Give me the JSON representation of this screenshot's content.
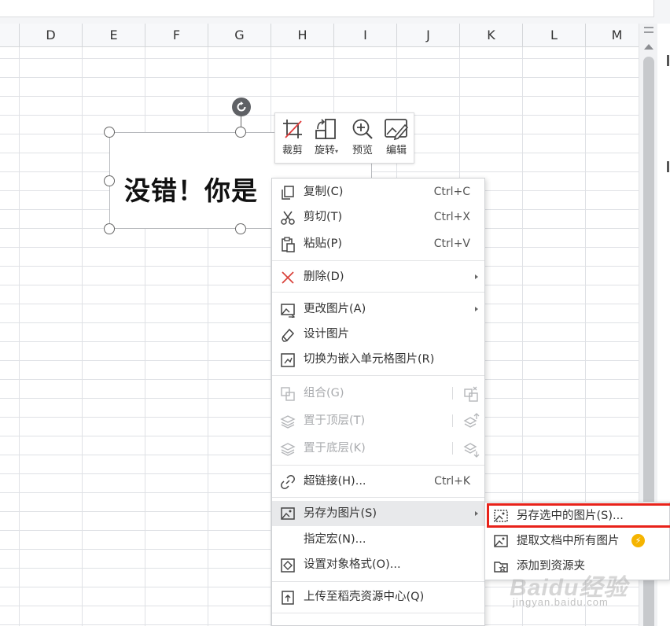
{
  "columns": [
    "D",
    "E",
    "F",
    "G",
    "H",
    "I",
    "J",
    "K",
    "L",
    "M"
  ],
  "image_text": "没错！你是",
  "mini_toolbar": [
    {
      "label": "裁剪",
      "icon": "crop-icon"
    },
    {
      "label": "旋转",
      "icon": "rotate-icon"
    },
    {
      "label": "预览",
      "icon": "zoom-preview-icon"
    },
    {
      "label": "编辑",
      "icon": "edit-image-icon"
    }
  ],
  "context_menu": {
    "copy": {
      "label": "复制(C)",
      "shortcut": "Ctrl+C"
    },
    "cut": {
      "label": "剪切(T)",
      "shortcut": "Ctrl+X"
    },
    "paste": {
      "label": "粘贴(P)",
      "shortcut": "Ctrl+V"
    },
    "delete": {
      "label": "删除(D)"
    },
    "change_picture": {
      "label": "更改图片(A)"
    },
    "design_picture": {
      "label": "设计图片"
    },
    "embed_cell": {
      "label": "切换为嵌入单元格图片(R)"
    },
    "group": {
      "label": "组合(G)"
    },
    "bring_front": {
      "label": "置于顶层(T)"
    },
    "send_back": {
      "label": "置于底层(K)"
    },
    "hyperlink": {
      "label": "超链接(H)...",
      "shortcut": "Ctrl+K"
    },
    "save_as_picture": {
      "label": "另存为图片(S)"
    },
    "assign_macro": {
      "label": "指定宏(N)..."
    },
    "format_object": {
      "label": "设置对象格式(O)..."
    },
    "upload": {
      "label": "上传至稻壳资源中心(Q)"
    }
  },
  "submenu": {
    "save_selected": "另存选中的图片(S)...",
    "extract_all": "提取文档中所有图片",
    "add_to_folder": "添加到资源夹"
  },
  "watermark": {
    "brand": "Baidu经验",
    "url": "jingyan.baidu.com"
  },
  "colors": {
    "highlight_border": "#e8221a",
    "badge": "#f5b400",
    "menu_hover": "#e8e9eb"
  }
}
